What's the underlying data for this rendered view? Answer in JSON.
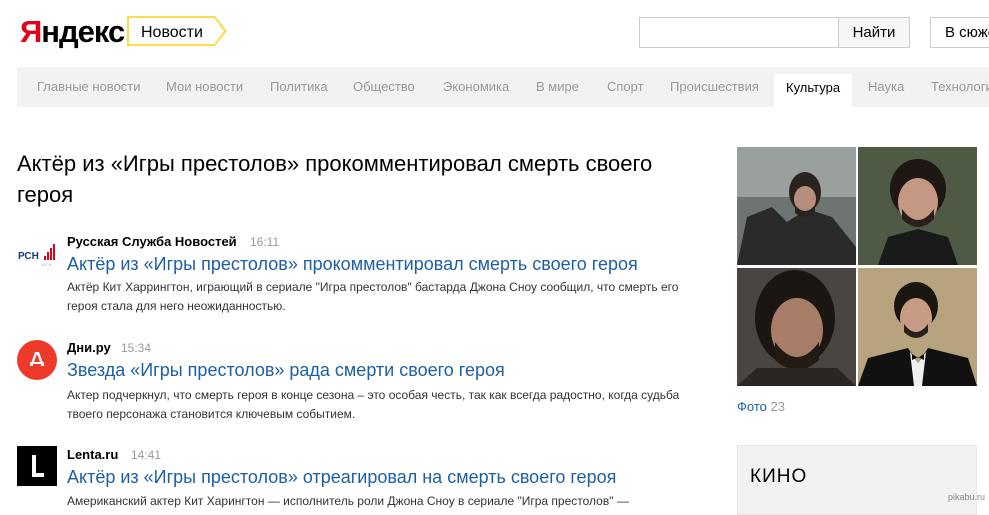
{
  "header": {
    "logo_first": "Я",
    "logo_rest": "ндекс",
    "service": "Новости",
    "search_placeholder": "",
    "search_button": "Найти",
    "story_button": "В сюжет"
  },
  "nav": {
    "items": [
      "Главные новости",
      "Мои новости",
      "Политика",
      "Общество",
      "Экономика",
      "В мире",
      "Спорт",
      "Происшествия",
      "Культура",
      "Наука",
      "Технологии"
    ],
    "active": "Культура"
  },
  "article": {
    "title": "Актёр из «Игры престолов» прокомментировал смерть своего героя"
  },
  "news": [
    {
      "source": "Русская Служба Новостей",
      "time": "16:11",
      "logo_icon": "rsn-logo-icon",
      "headline": "Актёр из «Игры престолов» прокомментировал смерть своего героя",
      "snippet": "Актёр Кит Харрингтон, играющий в сериале \"Игра престолов\" бастарда Джона Сноу сообщил, что смерть его героя стала для него неожиданностью."
    },
    {
      "source": "Дни.ру",
      "time": "15:34",
      "logo_icon": "dni-logo-icon",
      "headline": "Звезда «Игры престолов» рада смерти своего героя",
      "snippet": "Актер подчеркнул, что смерть героя в конце сезона – это особая честь, так как всегда радостно, когда судьба твоего персонажа становится ключевым событием."
    },
    {
      "source": "Lenta.ru",
      "time": "14:41",
      "logo_icon": "lenta-logo-icon",
      "headline": "Актёр из «Игры престолов» отреагировал на смерть своего героя",
      "snippet": "Американский актер Кит Харингтон — исполнитель роли Джона Сноу в сериале \"Игра престолов\" —"
    }
  ],
  "photos": {
    "label": "Фото",
    "count": "23"
  },
  "sidebar": {
    "kino_title": "КИНО"
  },
  "watermark": "pikabu.ru",
  "colors": {
    "link": "#1d5fa6",
    "logo_red": "#e4001b",
    "service_tag_border": "#ffdb4d",
    "nav_bg": "#f2f2f2"
  }
}
